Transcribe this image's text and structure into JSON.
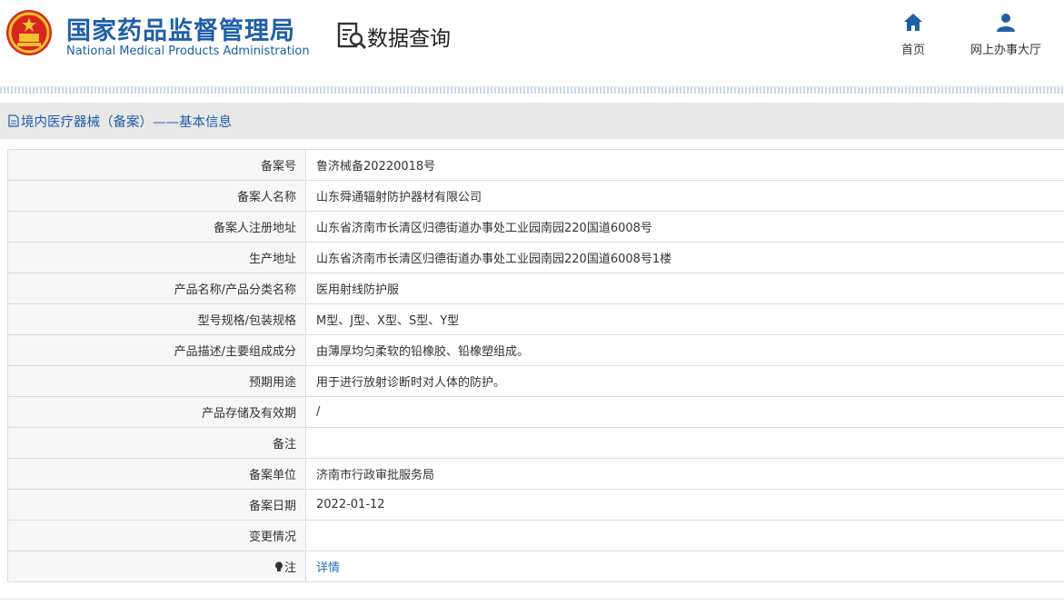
{
  "header": {
    "org_name_cn": "国家药品监督管理局",
    "org_name_en": "National Medical Products Administration",
    "page_title": "数据查询",
    "nav": [
      {
        "label": "首页",
        "icon": "home-icon"
      },
      {
        "label": "网上办事大厅",
        "icon": "user-icon"
      }
    ]
  },
  "section": {
    "title": "境内医疗器械（备案）——基本信息",
    "icon": "document-icon"
  },
  "record": [
    {
      "label": "备案号",
      "value": "鲁济械备20220018号"
    },
    {
      "label": "备案人名称",
      "value": "山东舜通辐射防护器材有限公司"
    },
    {
      "label": "备案人注册地址",
      "value": "山东省济南市长清区归德街道办事处工业园南园220国道6008号"
    },
    {
      "label": "生产地址",
      "value": "山东省济南市长清区归德街道办事处工业园南园220国道6008号1楼"
    },
    {
      "label": "产品名称/产品分类名称",
      "value": "医用射线防护服"
    },
    {
      "label": "型号规格/包装规格",
      "value": "M型、J型、X型、S型、Y型"
    },
    {
      "label": "产品描述/主要组成成分",
      "value": "由薄厚均匀柔软的铅橡胶、铅橡塑组成。"
    },
    {
      "label": "预期用途",
      "value": "用于进行放射诊断时对人体的防护。"
    },
    {
      "label": "产品存储及有效期",
      "value": "/"
    },
    {
      "label": "备注",
      "value": ""
    },
    {
      "label": "备案单位",
      "value": "济南市行政审批服务局"
    },
    {
      "label": "备案日期",
      "value": "2022-01-12"
    },
    {
      "label": "变更情况",
      "value": ""
    },
    {
      "label": "注",
      "value": "详情",
      "icon": "lightbulb-icon"
    }
  ],
  "colors": {
    "brand_blue": "#1f5fa8",
    "link_blue": "#2a6fb8",
    "section_bg": "#e8e8e8",
    "label_bg": "#f7f7f7"
  }
}
